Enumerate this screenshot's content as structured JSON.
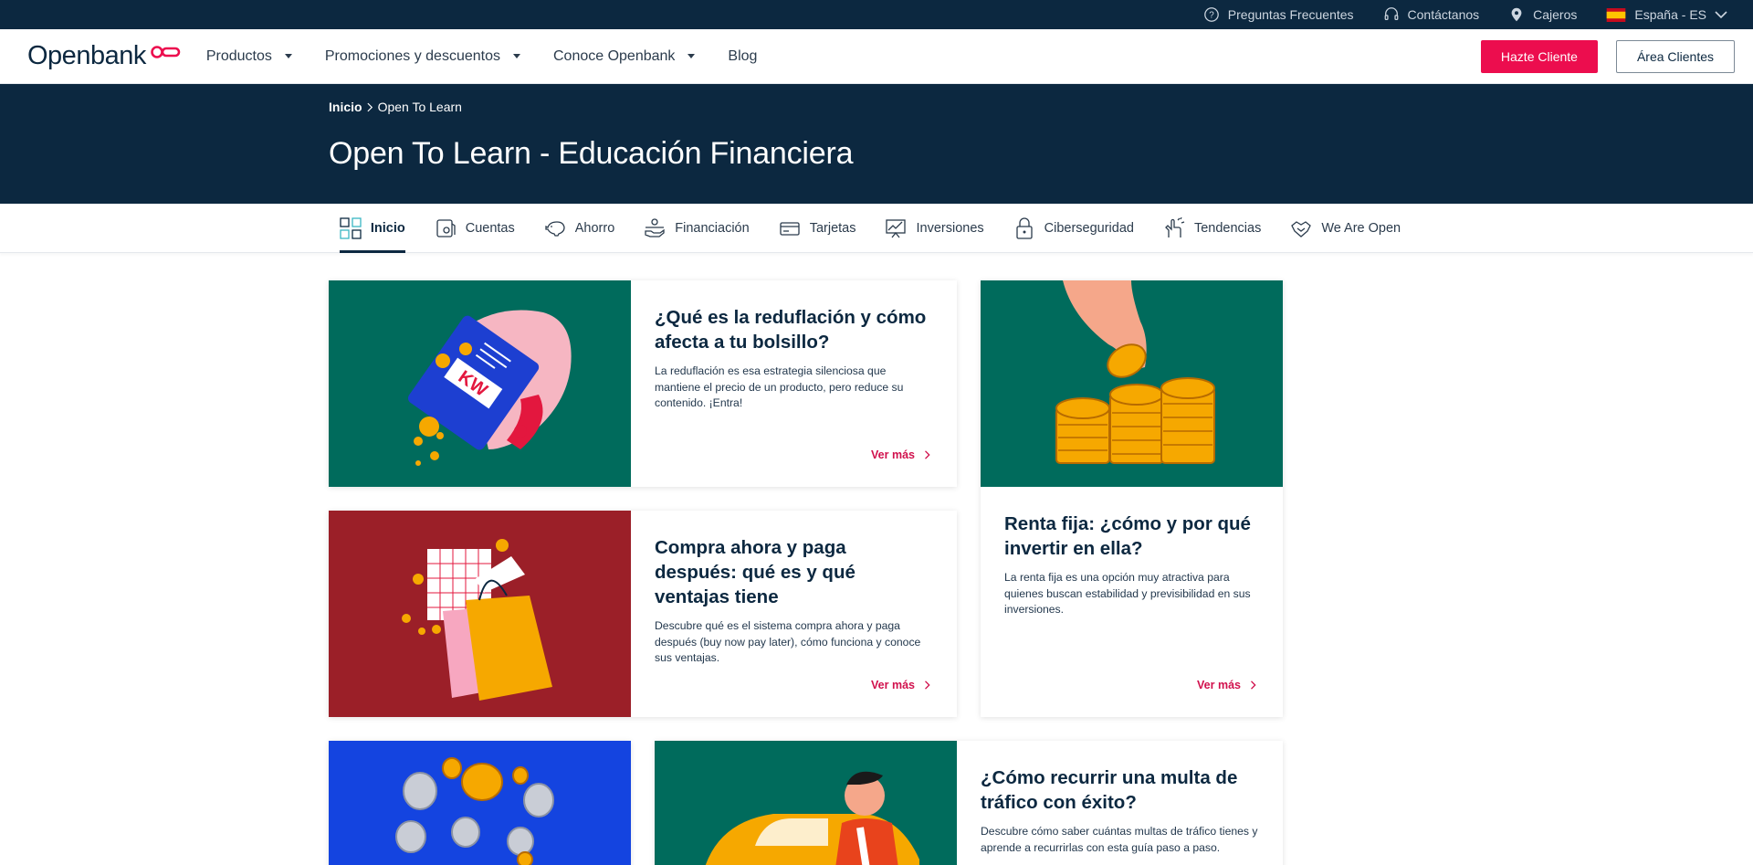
{
  "topbar": {
    "faq": "Preguntas Frecuentes",
    "contact": "Contáctanos",
    "atms": "Cajeros",
    "country": "España - ES"
  },
  "header": {
    "logo": "Openbank",
    "nav": [
      "Productos",
      "Promociones y descuentos",
      "Conoce Openbank",
      "Blog"
    ],
    "cta": "Hazte Cliente",
    "login": "Área Clientes"
  },
  "hero": {
    "crumb_home": "Inicio",
    "crumb_current": "Open To Learn",
    "title": "Open To Learn - Educación Financiera"
  },
  "subnav": {
    "tabs": [
      "Inicio",
      "Cuentas",
      "Ahorro",
      "Financiación",
      "Tarjetas",
      "Inversiones",
      "Ciberseguridad",
      "Tendencias",
      "We Are Open"
    ],
    "active": "Inicio"
  },
  "articles": [
    {
      "title": "¿Qué es la reduflación y cómo afecta a tu bolsillo?",
      "text": "La reduflación es esa estrategia silenciosa que mantiene el precio de un producto, pero reduce su contenido. ¡Entra!",
      "cta": "Ver más",
      "bg": "#006b5c"
    },
    {
      "title": "Renta fija: ¿cómo y por qué invertir en ella?",
      "text": "La renta fija es una opción muy atractiva para quienes buscan estabilidad y previsibilidad en sus inversiones.",
      "cta": "Ver más",
      "bg": "#006b5c"
    },
    {
      "title": "Compra ahora y paga después: qué es y qué ventajas tiene",
      "text": "Descubre qué es el sistema compra ahora y paga después (buy now pay later), cómo funciona y conoce sus ventajas.",
      "cta": "Ver más",
      "bg": "#9b1f28"
    },
    {
      "title": "¿Cómo recurrir una multa de tráfico con éxito?",
      "text": "Descubre cómo saber cuántas multas de tráfico tienes y aprende a recurrirlas con esta guía paso a paso.",
      "cta": "Ver más",
      "bg": "#006b5c"
    },
    {
      "bg": "#1444e0"
    }
  ],
  "colors": {
    "navy": "#0c2840",
    "accent": "#ec0d4e",
    "link": "#d1114d"
  },
  "icons": {
    "topbar": [
      "help-circle-icon",
      "headset-icon",
      "location-pin-icon",
      "spain-flag-icon",
      "chevron-down-icon"
    ],
    "subnav": [
      "grid-icon",
      "account-icon",
      "piggy-bank-icon",
      "financing-icon",
      "card-icon",
      "chart-icon",
      "lock-icon",
      "trends-icon",
      "handshake-icon"
    ]
  }
}
